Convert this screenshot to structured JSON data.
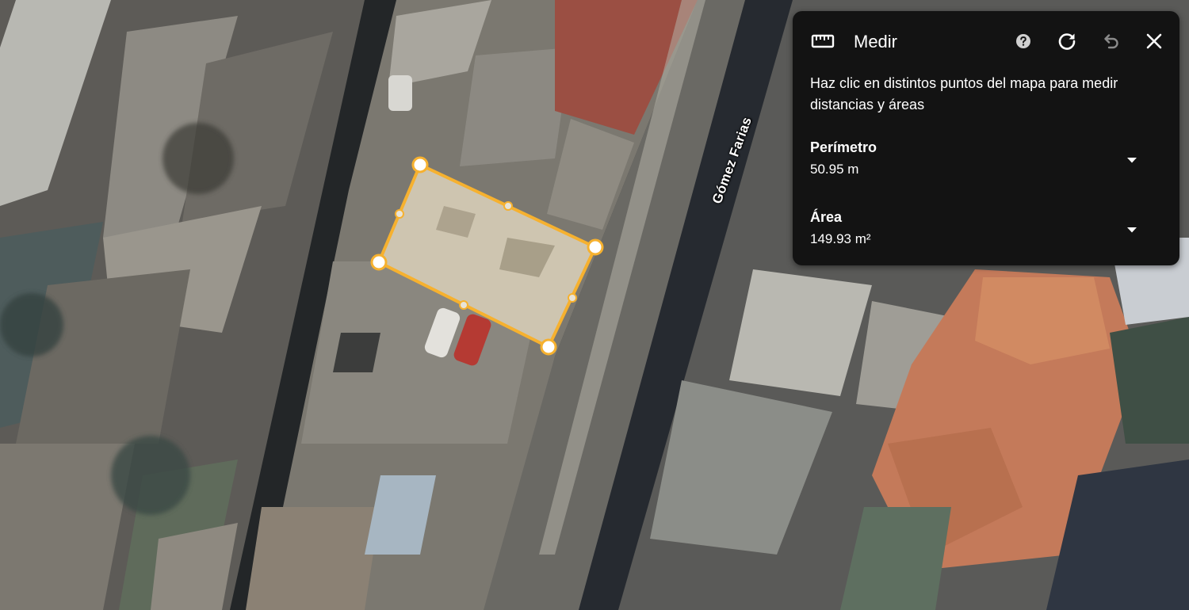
{
  "map": {
    "street_label": "Gómez Farias",
    "measure_color": "#f6b12f",
    "polygon": {
      "vertex_count": 4,
      "midpoint_handle_count": 4
    }
  },
  "panel": {
    "icon": "ruler-icon",
    "title": "Medir",
    "help_icon": "help-icon",
    "redo_icon": "redo-icon",
    "undo_icon": "undo-icon",
    "close_icon": "close-icon",
    "instruction": "Haz clic en distintos puntos del mapa para medir distancias y áreas",
    "perimeter": {
      "label": "Perímetro",
      "value": "50.95 m",
      "dropdown_icon": "caret-down-icon"
    },
    "area": {
      "label": "Área",
      "value": "149.93 m²",
      "dropdown_icon": "caret-down-icon"
    }
  },
  "colors": {
    "panel_bg": "#131313",
    "text": "#ffffff",
    "undo_disabled": "#8a8a8a"
  }
}
